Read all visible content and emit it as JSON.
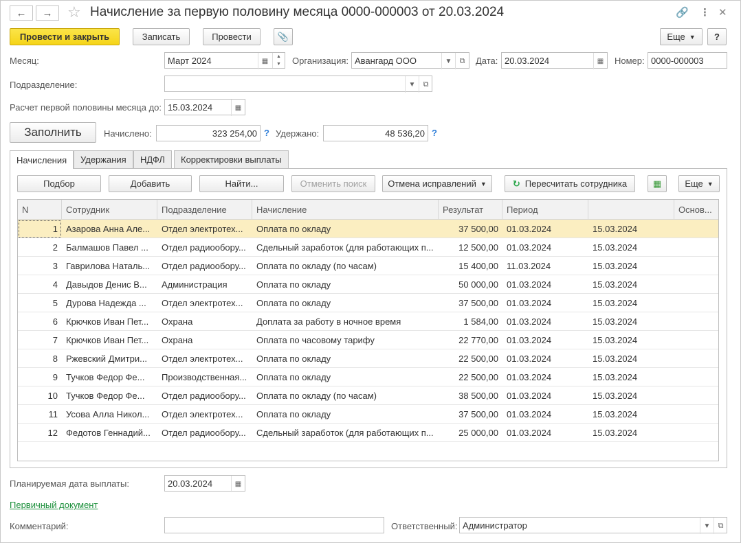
{
  "window": {
    "title": "Начисление за первую половину месяца 0000-000003 от 20.03.2024"
  },
  "toolbar": {
    "post_close": "Провести и закрыть",
    "save": "Записать",
    "post": "Провести",
    "more": "Еще",
    "help": "?"
  },
  "form": {
    "month_label": "Месяц:",
    "month_value": "Март 2024",
    "org_label": "Организация:",
    "org_value": "Авангард ООО",
    "date_label": "Дата:",
    "date_value": "20.03.2024",
    "number_label": "Номер:",
    "number_value": "0000-000003",
    "division_label": "Подразделение:",
    "division_value": "",
    "calc_until_label": "Расчет первой половины месяца до:",
    "calc_until_value": "15.03.2024",
    "fill_button": "Заполнить",
    "accrued_label": "Начислено:",
    "accrued_value": "323 254,00",
    "withheld_label": "Удержано:",
    "withheld_value": "48 536,20",
    "help_mark": "?"
  },
  "tabs": [
    "Начисления",
    "Удержания",
    "НДФЛ",
    "Корректировки выплаты"
  ],
  "table_toolbar": {
    "pick": "Подбор",
    "add": "Добавить",
    "find": "Найти...",
    "cancel_search": "Отменить поиск",
    "cancel_fixes": "Отмена исправлений",
    "recalc": "Пересчитать сотрудника",
    "more": "Еще"
  },
  "table": {
    "columns": [
      "N",
      "Сотрудник",
      "Подразделение",
      "Начисление",
      "Результат",
      "Период",
      "",
      "Основ..."
    ],
    "rows": [
      [
        "1",
        "Азарова Анна Але...",
        "Отдел электротех...",
        "Оплата по окладу",
        "37 500,00",
        "01.03.2024",
        "15.03.2024",
        ""
      ],
      [
        "2",
        "Балмашов Павел ...",
        "Отдел радиообору...",
        "Сдельный заработок (для работающих п...",
        "12 500,00",
        "01.03.2024",
        "15.03.2024",
        ""
      ],
      [
        "3",
        "Гаврилова Наталь...",
        "Отдел радиообору...",
        "Оплата по окладу (по часам)",
        "15 400,00",
        "11.03.2024",
        "15.03.2024",
        ""
      ],
      [
        "4",
        "Давыдов Денис В...",
        "Администрация",
        "Оплата по окладу",
        "50 000,00",
        "01.03.2024",
        "15.03.2024",
        ""
      ],
      [
        "5",
        "Дурова Надежда ...",
        "Отдел электротех...",
        "Оплата по окладу",
        "37 500,00",
        "01.03.2024",
        "15.03.2024",
        ""
      ],
      [
        "6",
        "Крючков Иван Пет...",
        "Охрана",
        "Доплата за работу в ночное время",
        "1 584,00",
        "01.03.2024",
        "15.03.2024",
        ""
      ],
      [
        "7",
        "Крючков Иван Пет...",
        "Охрана",
        "Оплата по часовому тарифу",
        "22 770,00",
        "01.03.2024",
        "15.03.2024",
        ""
      ],
      [
        "8",
        "Ржевский Дмитри...",
        "Отдел электротех...",
        "Оплата по окладу",
        "22 500,00",
        "01.03.2024",
        "15.03.2024",
        ""
      ],
      [
        "9",
        "Тучков Федор Фе...",
        "Производственная...",
        "Оплата по окладу",
        "22 500,00",
        "01.03.2024",
        "15.03.2024",
        ""
      ],
      [
        "10",
        "Тучков Федор Фе...",
        "Отдел радиообору...",
        "Оплата по окладу (по часам)",
        "38 500,00",
        "01.03.2024",
        "15.03.2024",
        ""
      ],
      [
        "11",
        "Усова Алла Никол...",
        "Отдел электротех...",
        "Оплата по окладу",
        "37 500,00",
        "01.03.2024",
        "15.03.2024",
        ""
      ],
      [
        "12",
        "Федотов Геннадий...",
        "Отдел радиообору...",
        "Сдельный заработок (для работающих п...",
        "25 000,00",
        "01.03.2024",
        "15.03.2024",
        ""
      ]
    ]
  },
  "footer": {
    "pay_date_label": "Планируемая дата выплаты:",
    "pay_date_value": "20.03.2024",
    "primary_doc_link": "Первичный документ",
    "comment_label": "Комментарий:",
    "comment_value": "",
    "responsible_label": "Ответственный:",
    "responsible_value": "Администратор"
  },
  "colors": {
    "primary_button": "#f5d418",
    "selected_row": "#fbeec1",
    "link": "#1a8f3a",
    "help": "#2f7ed8"
  }
}
